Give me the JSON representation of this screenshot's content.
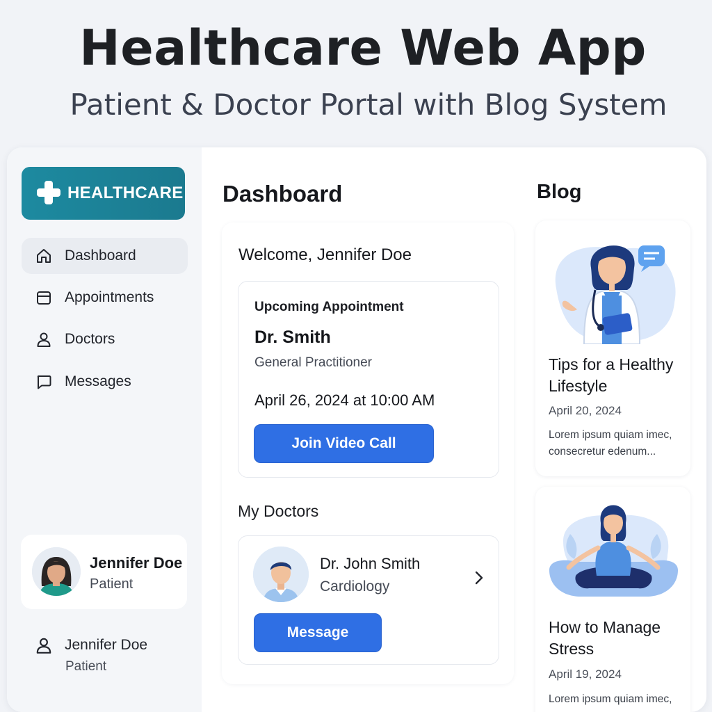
{
  "hero": {
    "title": "Healthcare Web App",
    "subtitle": "Patient & Doctor Portal with Blog System"
  },
  "brand": {
    "name": "HEALTHCARE",
    "icon": "medical-cross-icon",
    "color": "#1d8aa0"
  },
  "sidebar": {
    "items": [
      {
        "label": "Dashboard",
        "icon": "home-icon",
        "active": true
      },
      {
        "label": "Appointments",
        "icon": "calendar-icon",
        "active": false
      },
      {
        "label": "Doctors",
        "icon": "user-icon",
        "active": false
      },
      {
        "label": "Messages",
        "icon": "chat-bubble-icon",
        "active": false
      }
    ],
    "profile": {
      "name": "Jennifer Doe",
      "role": "Patient"
    },
    "footer_user": {
      "name": "Jennifer Doe",
      "role": "Patient",
      "icon": "user-icon"
    }
  },
  "main": {
    "title": "Dashboard",
    "welcome": "Welcome, Jennifer Doe",
    "appointment": {
      "label": "Upcoming Appointment",
      "doctor": "Dr. Smith",
      "specialty": "General Practitioner",
      "datetime": "April 26, 2024 at 10:00 AM",
      "button": "Join Video Call"
    },
    "my_doctors": {
      "heading": "My Doctors",
      "doctor": {
        "name": "Dr. John Smith",
        "specialty": "Cardiology"
      },
      "button": "Message"
    }
  },
  "blog": {
    "title": "Blog",
    "posts": [
      {
        "title": "Tips for a Healthy Lifestyle",
        "date": "April 20, 2024",
        "excerpt": "Lorem ipsum quiam imec, consecretur edenum..."
      },
      {
        "title": "How to Manage Stress",
        "date": "April 19, 2024",
        "excerpt": "Lorem ipsum quiam imec,"
      }
    ]
  },
  "colors": {
    "primary_button": "#2f6fe4",
    "background": "#f1f3f7",
    "sidebar": "#f4f6f9"
  }
}
